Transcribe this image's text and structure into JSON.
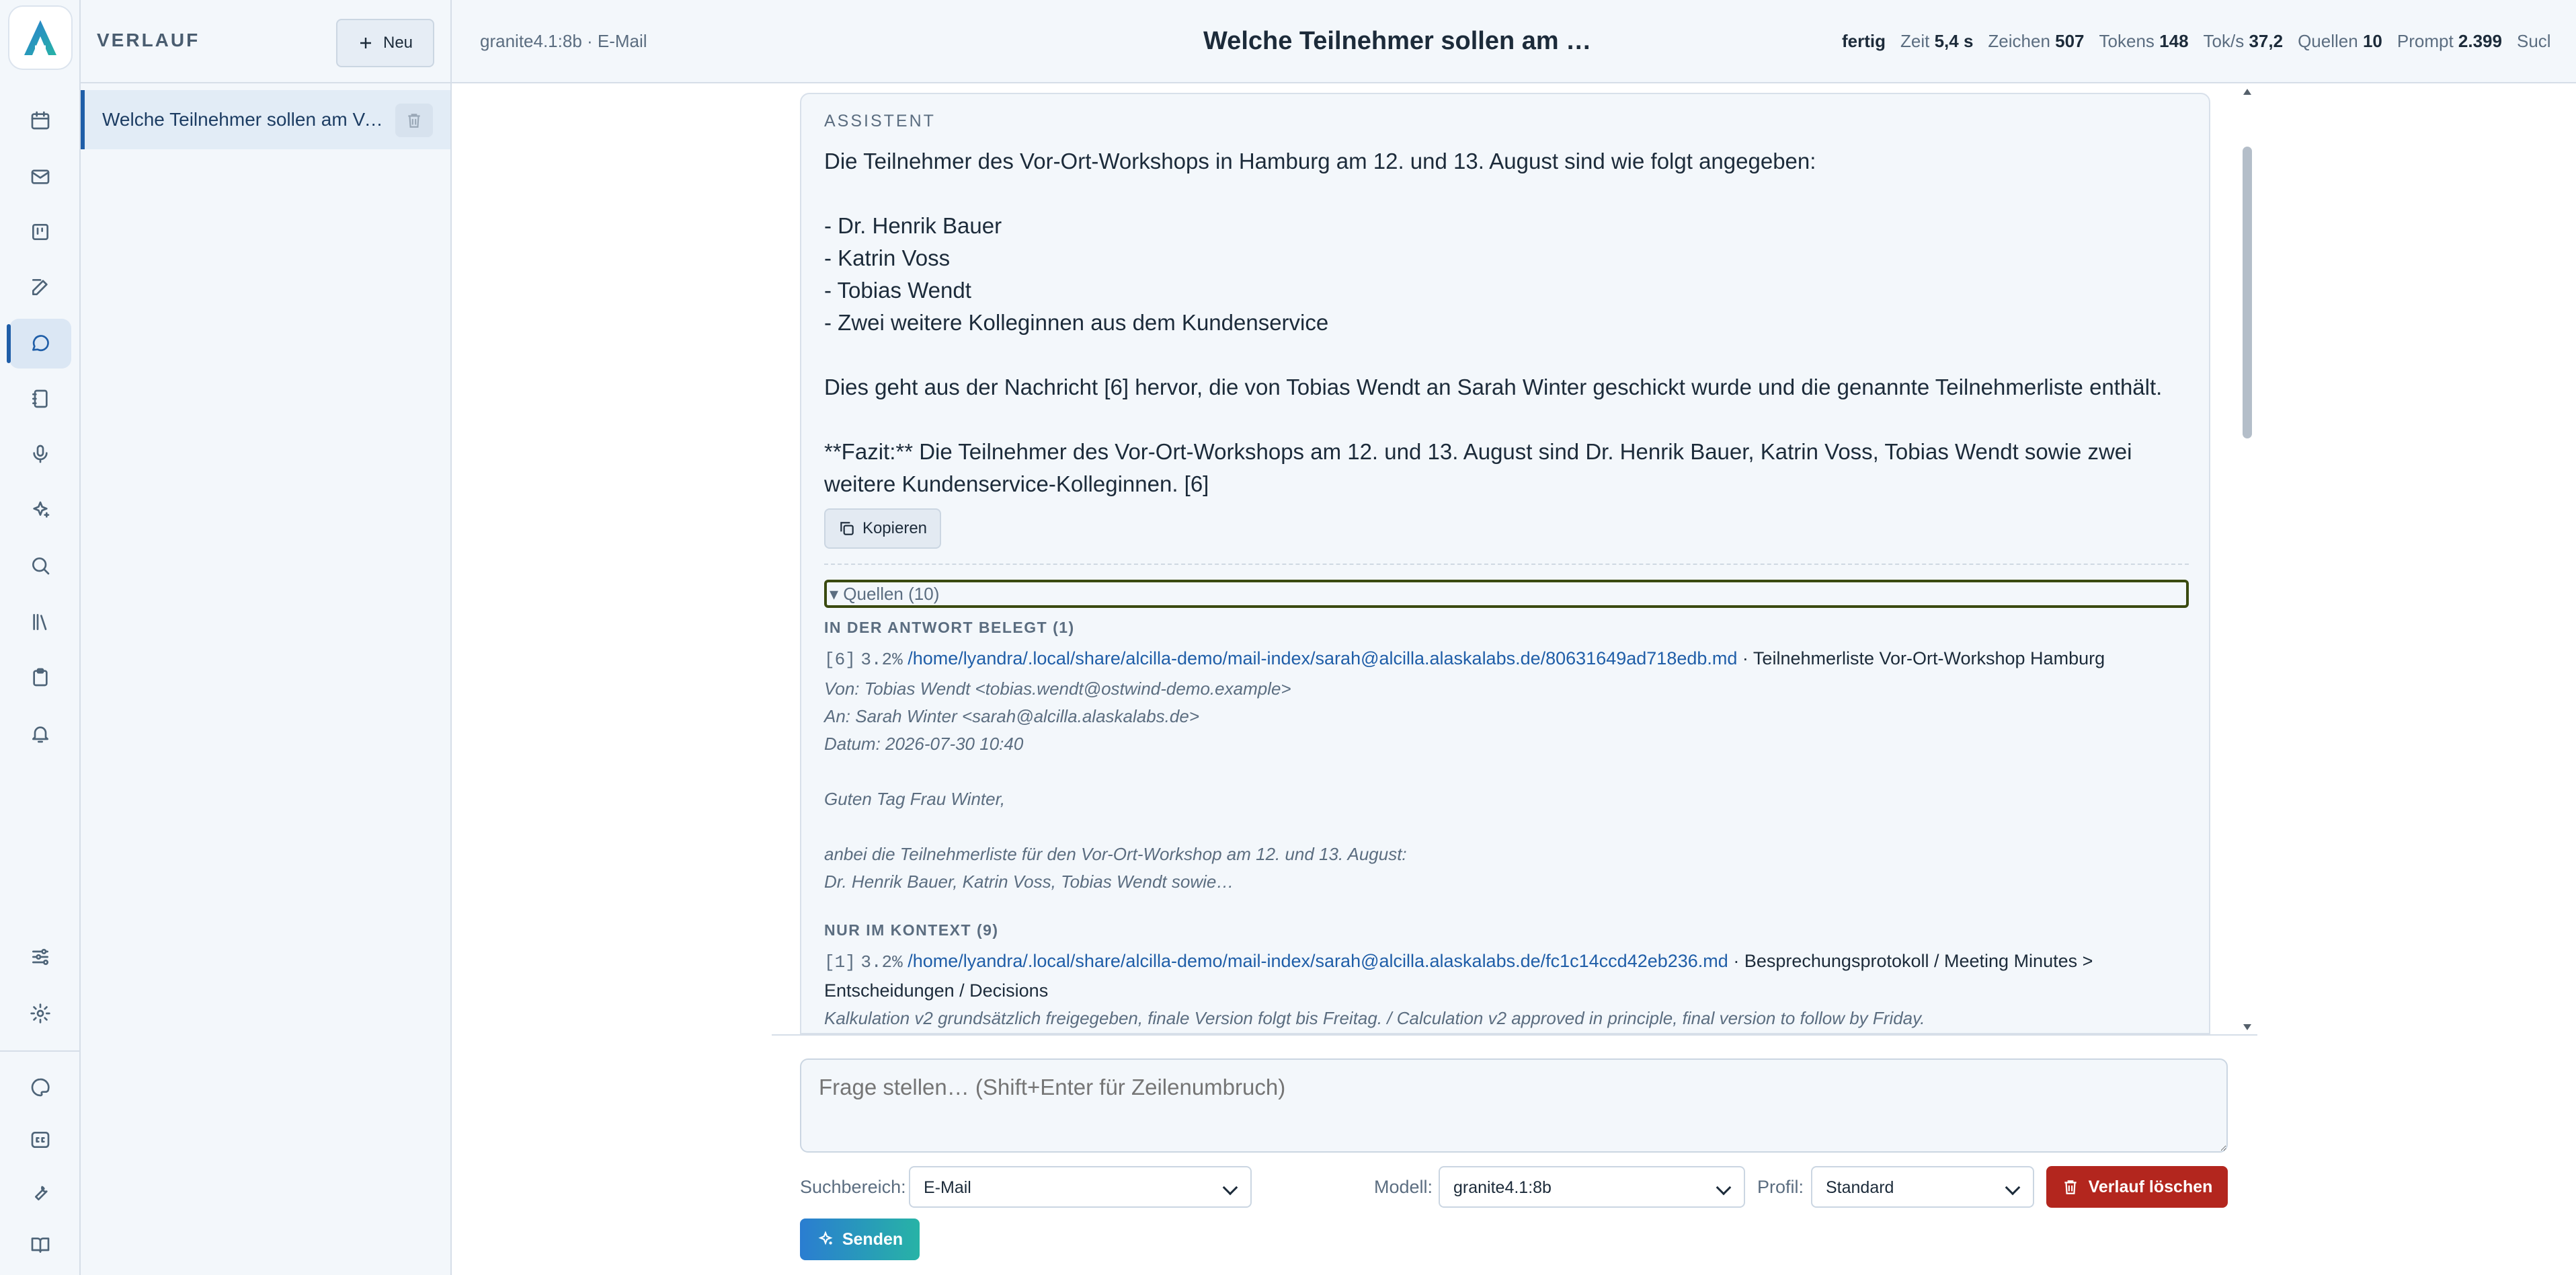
{
  "rail": {
    "icons": [
      "calendar-icon",
      "mail-icon",
      "board-icon",
      "edit-icon",
      "chat-icon",
      "notebook-icon",
      "microphone-icon",
      "sparkles-icon",
      "search-icon",
      "library-icon",
      "clipboard-icon",
      "bell-icon",
      "sliders-icon",
      "gear-icon",
      "palette-icon",
      "caption-icon",
      "wrench-icon",
      "book-icon"
    ],
    "active": "chat-icon"
  },
  "sidebar": {
    "title": "VERLAUF",
    "new_label": "Neu",
    "items": [
      {
        "label": "Welche Teilnehmer sollen am Vor-Ort-Workshop in Hamburg teilnehmen?"
      }
    ]
  },
  "topbar": {
    "meta": "granite4.1:8b · E-Mail",
    "title": "Welche Teilnehmer sollen am Vor-Ort-Workshop in Hamburg teilnehmen?",
    "status": "fertig",
    "stats": [
      {
        "key": "Zeit",
        "value": "5,4 s"
      },
      {
        "key": "Zeichen",
        "value": "507"
      },
      {
        "key": "Tokens",
        "value": "148"
      },
      {
        "key": "Tok/s",
        "value": "37,2"
      },
      {
        "key": "Quellen",
        "value": "10"
      },
      {
        "key": "Prompt",
        "value": "2.399"
      },
      {
        "key": "Sucl",
        "value": ""
      }
    ]
  },
  "message": {
    "role": "ASSISTENT",
    "lines": [
      "Die Teilnehmer des Vor-Ort-Workshops in Hamburg am 12. und 13. August sind wie folgt angegeben:",
      "",
      "- Dr. Henrik Bauer",
      "- Katrin Voss",
      "- Tobias Wendt",
      "- Zwei weitere Kolleginnen aus dem Kundenservice",
      "",
      "Dies geht aus der Nachricht [6] hervor, die von Tobias Wendt an Sarah Winter geschickt wurde und die genannte Teilnehmerliste enthält.",
      "",
      "**Fazit:** Die Teilnehmer des Vor-Ort-Workshops am 12. und 13. August sind Dr. Henrik Bauer, Katrin Voss, Tobias Wendt sowie zwei weitere Kundenservice-Kolleginnen. [6]"
    ],
    "copy_label": "Kopieren"
  },
  "sources": {
    "summary": "▾ Quellen (10)",
    "cited_head": "IN DER ANTWORT BELEGT (1)",
    "cited": [
      {
        "ref": "[6]",
        "pct": "3.2%",
        "path": "/home/lyandra/.local/share/alcilla-demo/mail-index/sarah@alcilla.alaskalabs.de/80631649ad718edb.md",
        "title": "· Teilnehmerliste Vor-Ort-Workshop Hamburg",
        "excerpt": [
          "Von: Tobias Wendt <tobias.wendt@ostwind-demo.example>",
          "An: Sarah Winter <sarah@alcilla.alaskalabs.de>",
          "Datum: 2026-07-30 10:40",
          "",
          "Guten Tag Frau Winter,",
          "",
          "anbei die Teilnehmerliste für den Vor-Ort-Workshop am 12. und 13. August:",
          "Dr. Henrik Bauer, Katrin Voss, Tobias Wendt sowie…"
        ]
      }
    ],
    "context_head": "NUR IM KONTEXT (9)",
    "context": [
      {
        "ref": "[1]",
        "pct": "3.2%",
        "path": "/home/lyandra/.local/share/alcilla-demo/mail-index/sarah@alcilla.alaskalabs.de/fc1c14ccd42eb236.md",
        "title": "· Besprechungsprotokoll / Meeting Minutes > Entscheidungen / Decisions",
        "excerpt": [
          "Kalkulation v2 grundsätzlich freigegeben, finale Version folgt bis Freitag. / Calculation v2 approved in principle, final version to follow by Friday."
        ]
      }
    ]
  },
  "composer": {
    "placeholder": "Frage stellen… (Shift+Enter für Zeilenumbruch)",
    "scope_label": "Suchbereich:",
    "scope_value": "E-Mail",
    "model_label": "Modell:",
    "model_value": "granite4.1:8b",
    "profile_label": "Profil:",
    "profile_value": "Standard",
    "clear_label": "Verlauf löschen",
    "send_label": "Senden"
  },
  "colors": {
    "accent": "#1f5ea8",
    "danger": "#b3261e",
    "send_gradient_start": "#2a7dd1",
    "send_gradient_end": "#27b3a6"
  }
}
